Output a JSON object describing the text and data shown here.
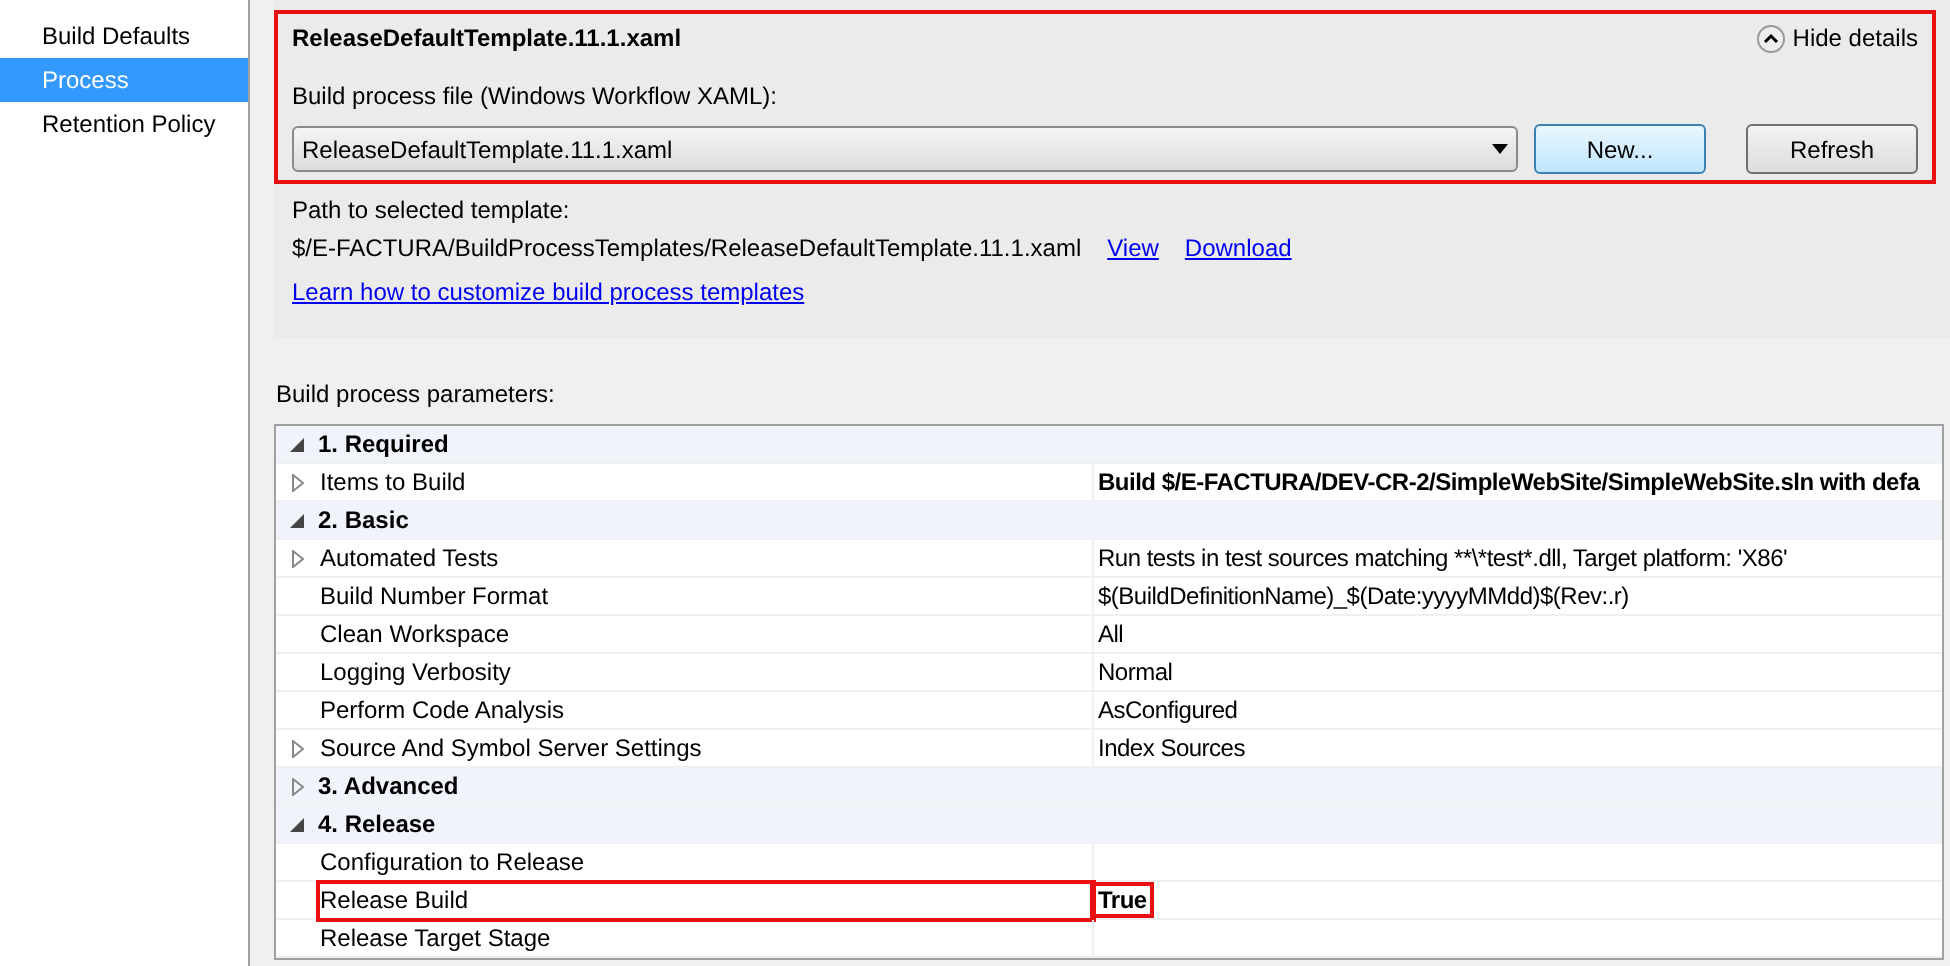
{
  "sidebar": {
    "items": [
      {
        "label": "Build Defaults",
        "selected": false
      },
      {
        "label": "Process",
        "selected": true
      },
      {
        "label": "Retention Policy",
        "selected": false
      }
    ]
  },
  "template": {
    "highlighted": true,
    "title": "ReleaseDefaultTemplate.11.1.xaml",
    "toggle": "Hide details",
    "file_label": "Build process file (Windows Workflow XAML):",
    "file_value": "ReleaseDefaultTemplate.11.1.xaml",
    "buttons": [
      {
        "label": "New...",
        "kind": "default"
      },
      {
        "label": "Refresh",
        "kind": "normal"
      }
    ],
    "path_label": "Path to selected template:",
    "path": "$/E-FACTURA/BuildProcessTemplates/ReleaseDefaultTemplate.11.1.xaml",
    "links": [
      "View",
      "Download"
    ],
    "help_link": "Learn how to customize build process templates"
  },
  "parameters": {
    "label": "Build process parameters:",
    "rows": [
      {
        "kind": "category",
        "name": "1. Required",
        "expanded": true
      },
      {
        "kind": "param",
        "name": "Items to Build",
        "expandable": true,
        "value": "Build $/E-FACTURA/DEV-CR-2/SimpleWebSite/SimpleWebSite.sln with defa",
        "bold": true,
        "highlighted": false
      },
      {
        "kind": "category",
        "name": "2. Basic",
        "expanded": true
      },
      {
        "kind": "param",
        "name": "Automated Tests",
        "expandable": true,
        "value": "Run tests in test sources matching **\\*test*.dll, Target platform: 'X86'",
        "bold": false,
        "highlighted": false
      },
      {
        "kind": "param",
        "name": "Build Number Format",
        "expandable": false,
        "value": "$(BuildDefinitionName)_$(Date:yyyyMMdd)$(Rev:.r)",
        "bold": false,
        "highlighted": false
      },
      {
        "kind": "param",
        "name": "Clean Workspace",
        "expandable": false,
        "value": "All",
        "bold": false,
        "highlighted": false
      },
      {
        "kind": "param",
        "name": "Logging Verbosity",
        "expandable": false,
        "value": "Normal",
        "bold": false,
        "highlighted": false
      },
      {
        "kind": "param",
        "name": "Perform Code Analysis",
        "expandable": false,
        "value": "AsConfigured",
        "bold": false,
        "highlighted": false
      },
      {
        "kind": "param",
        "name": "Source And Symbol Server Settings",
        "expandable": true,
        "value": "Index Sources",
        "bold": false,
        "highlighted": false
      },
      {
        "kind": "category",
        "name": "3. Advanced",
        "expanded": false
      },
      {
        "kind": "category",
        "name": "4. Release",
        "expanded": true
      },
      {
        "kind": "param",
        "name": "Configuration to Release",
        "expandable": false,
        "bold": false,
        "highlighted": false
      },
      {
        "kind": "param",
        "name": "Release Build",
        "expandable": false,
        "value": "True",
        "bold": true,
        "highlighted": true
      },
      {
        "kind": "param",
        "name": "Release Target Stage",
        "expandable": false,
        "bold": false,
        "highlighted": false
      }
    ]
  }
}
